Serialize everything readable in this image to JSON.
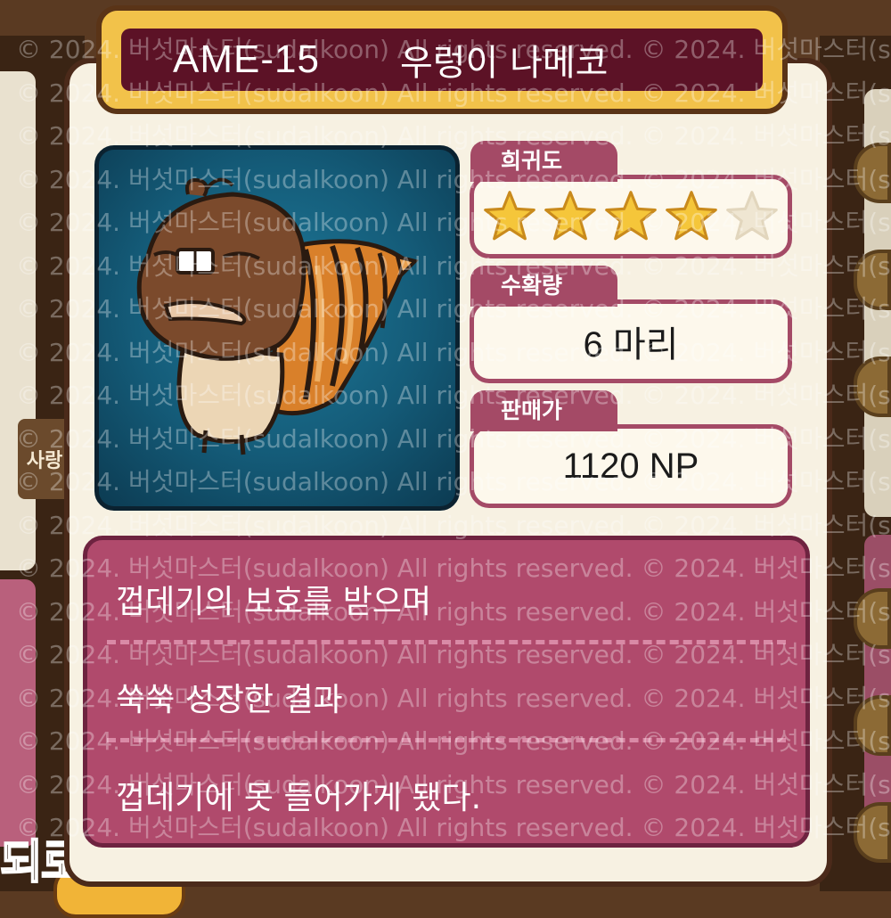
{
  "card": {
    "code": "AME-15",
    "name": "우렁이 나메코",
    "portrait_icon": "snail-shell-namekoo-icon"
  },
  "rarity": {
    "label": "희귀도",
    "stars_filled": 4,
    "stars_total": 5
  },
  "harvest": {
    "label": "수확량",
    "value": "6 마리"
  },
  "price": {
    "label": "판매가",
    "value": "1120 NP"
  },
  "description": {
    "lines": [
      "껍데기의 보호를 받으며",
      "쑥쑥 성장한 결과",
      "껍데기에 못 들어가게 됐다."
    ]
  },
  "background": {
    "left_tag": "사랑",
    "bottom_text": "되로"
  },
  "watermark": "© 2024. 버섯마스터(sudalkoon) All rights reserved.",
  "colors": {
    "title_bg": "#5c1226",
    "title_frame": "#f2c24a",
    "accent": "#a44a66",
    "description_bg": "#b04a6c",
    "panel_bg": "#f7f1e2",
    "star_filled": "#f5c63a",
    "star_empty": "#efe6d2"
  }
}
